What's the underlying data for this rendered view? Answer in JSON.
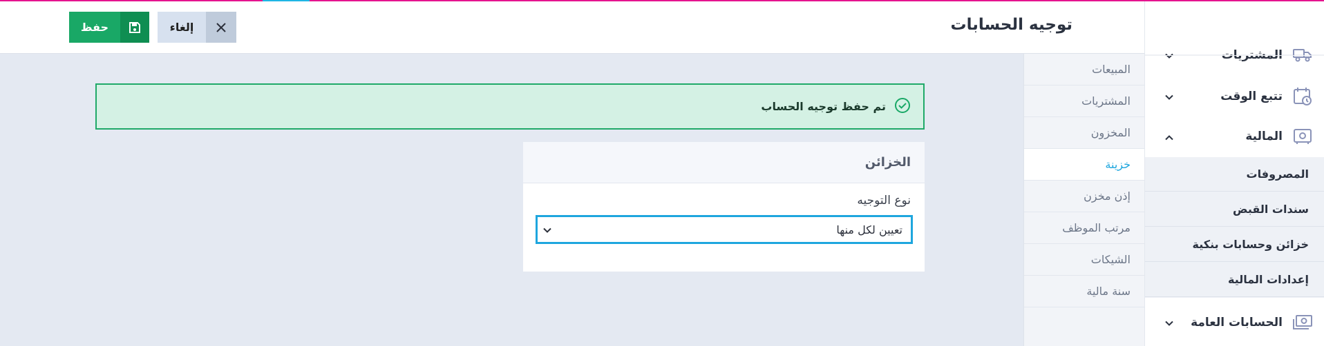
{
  "header": {
    "title": "توجيه الحسابات",
    "save_label": "حفظ",
    "cancel_label": "إلغاء"
  },
  "alert": {
    "message": "تم حفظ توجيه الحساب"
  },
  "subnav": {
    "items": [
      {
        "label": "المبيعات"
      },
      {
        "label": "المشتريات"
      },
      {
        "label": "المخزون"
      },
      {
        "label": "خزينة",
        "active": true
      },
      {
        "label": "إذن مخزن"
      },
      {
        "label": "مرتب الموظف"
      },
      {
        "label": "الشيكات"
      },
      {
        "label": "سنة مالية"
      }
    ]
  },
  "card": {
    "title": "الخزائن",
    "field_label": "نوع التوجيه",
    "select_value": "تعيين لكل منها"
  },
  "sidebar": {
    "top_item": "المشتريات",
    "time_tracking": "تتبع الوقت",
    "finance": "المالية",
    "finance_items": [
      "المصروفات",
      "سندات القبض",
      "خزائن وحسابات بنكية",
      "إعدادات المالية"
    ],
    "general_accounts": "الحسابات العامة"
  },
  "colors": {
    "accent": "#1ea6de",
    "success": "#19a866",
    "top_bar": "#e5148f"
  }
}
